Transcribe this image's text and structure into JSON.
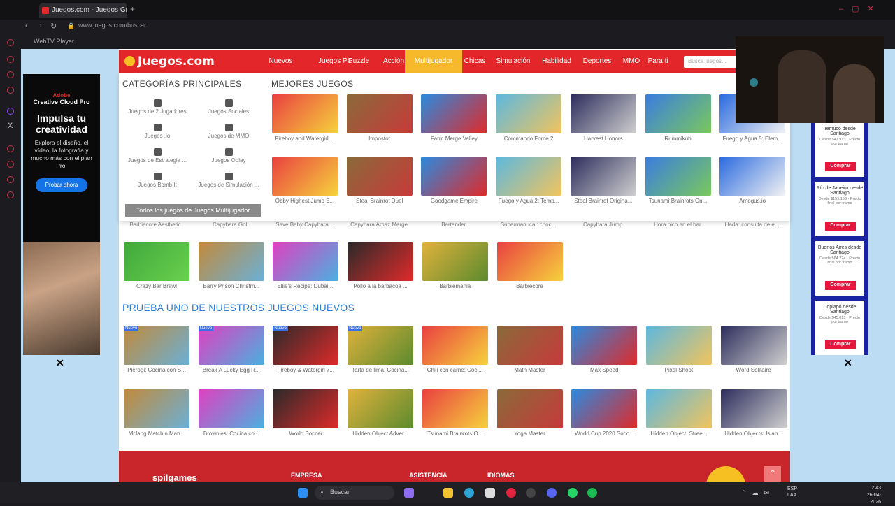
{
  "browser": {
    "tab_title": "Juegos.com - Juegos Gra",
    "url": "www.juegos.com/buscar",
    "bookmark": "WebTV Player"
  },
  "site": {
    "logo": "Juegos.com",
    "nav": [
      "Nuevos",
      "Juegos PC",
      "Puzzle",
      "Acción",
      "Multijugador",
      "Chicas",
      "Simulación",
      "Habilidad",
      "Deportes",
      "MMO",
      "Para ti"
    ],
    "active_nav": "Multijugador",
    "search_placeholder": "Busca juegos...",
    "categories_heading": "CATEGORÍAS PRINCIPALES",
    "best_heading": "MEJORES JUEGOS",
    "categories": [
      "Juegos de 2 Jugadores",
      "Juegos Sociales",
      "Juegos .io",
      "Juegos de MMO",
      "Juegos de Estrategia ...",
      "Juegos Oplay",
      "Juegos Bomb It",
      "Juegos de Simulación ..."
    ],
    "all_button": "Todos los juegos de Juegos Multijugador",
    "best_games": [
      "Fireboy and Watergirl ...",
      "Impostor",
      "Farm Merge Valley",
      "Commando Force 2",
      "Harvest Honors",
      "Rummikub",
      "Fuego y Agua 5: Elem...",
      "Obby Highest Jump E...",
      "Steal Brainrot Duel",
      "Goodgame Empire",
      "Fuego y Agua 2: Temp...",
      "Steal Brainrot Origina...",
      "Tsunami Brainrots On...",
      "Amogus.io"
    ],
    "hidden_row": [
      "Barbiecore Aesthetic",
      "Capybara Gol",
      "Save Baby Capybara...",
      "Capybara Amaz Merge",
      "Bartender",
      "Supermanucai: choc...",
      "Capybara Jump",
      "Hora pico en el bar",
      "Hada: consulta de e..."
    ],
    "row_b": [
      "Crazy Bar Brawl",
      "Barry Prison Christm...",
      "Ellie's Recipe: Dubai ...",
      "Pollo a la barbacoa ...",
      "Barbiemania",
      "Barbiecore"
    ],
    "new_heading": "PRUEBA UNO DE NUESTROS JUEGOS NUEVOS",
    "new_row1": [
      "Pierogi: Cocina con S...",
      "Break A Lucky Egg R...",
      "Fireboy & Watergirl 7...",
      "Tarta de lima: Cocina...",
      "Chili con carne: Coci...",
      "Math Master",
      "Max Speed",
      "Pixel Shoot",
      "Word Solitaire"
    ],
    "new_row2": [
      "Mclang Matchin Man...",
      "Brownies: Cocina co...",
      "World Soccer",
      "Hidden Object Adver...",
      "Tsunami Brainrots O...",
      "Yoga Master",
      "World Cup 2020 Socc...",
      "Hidden Object: Stree...",
      "Hidden Objects: Islan..."
    ],
    "new_badge": "Nuevo",
    "footer": {
      "brand": "spilgames",
      "empresa": "EMPRESA",
      "asistencia": "ASISTENCIA",
      "idiomas": "IDIOMAS"
    }
  },
  "left_ad": {
    "brand": "Adobe",
    "product": "Creative Cloud Pro",
    "headline": "Impulsa tu creatividad",
    "body": "Explora el diseño, el vídeo, la fotografía y mucho más con el plan Pro.",
    "cta": "Probar ahora"
  },
  "right_ad": {
    "cards": [
      {
        "title": "Temuco desde Santiago",
        "detail": "Desde $47.913 · Precio por tramo",
        "cta": "Comprar"
      },
      {
        "title": "Río de Janeiro desde Santiago",
        "detail": "Desde $159.153 · Precio final por tramo",
        "cta": "Comprar"
      },
      {
        "title": "Buenos Aires desde Santiago",
        "detail": "Desde $64.224 · Precio final por tramo",
        "cta": "Comprar"
      },
      {
        "title": "Copiapó desde Santiago",
        "detail": "Desde $45.013 · Precio por tramo",
        "cta": "Comprar"
      }
    ]
  },
  "close_symbol": "✕",
  "taskbar": {
    "search": "Buscar",
    "lang": "ESP\nLAA",
    "time": "2:43",
    "date": "26-04-2026"
  },
  "colors": {
    "brand_red": "#e3262a",
    "active_nav": "#f6b92c",
    "link_blue": "#2a7fd8",
    "ad_blue": "#1b24a0"
  }
}
